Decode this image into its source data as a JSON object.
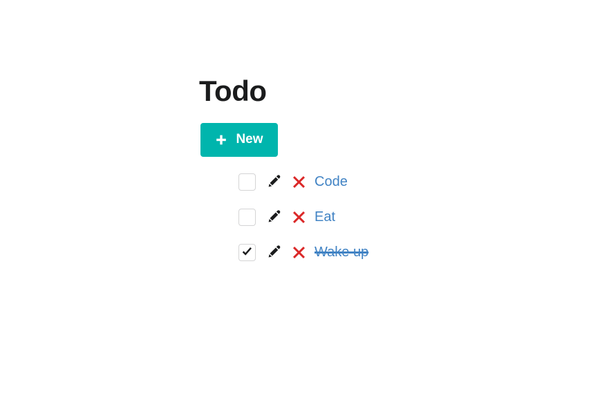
{
  "page": {
    "title": "Todo",
    "background_color": "#ffffff"
  },
  "toolbar": {
    "new_label": "New",
    "new_icon": "plus-icon",
    "accent_color": "#00b5ad",
    "new_text_color": "#ffffff"
  },
  "list": {
    "link_color": "#4183c4",
    "delete_color": "#db2828",
    "edit_color": "#1b1c1d",
    "checkbox_border_color": "#d4d4d5",
    "items": [
      {
        "label": "Code",
        "done": false,
        "checkbox_name": "todo-checkbox-code",
        "edit_name": "edit-todo-code-button",
        "delete_name": "delete-todo-code-button"
      },
      {
        "label": "Eat",
        "done": false,
        "checkbox_name": "todo-checkbox-eat",
        "edit_name": "edit-todo-eat-button",
        "delete_name": "delete-todo-eat-button"
      },
      {
        "label": "Wake up",
        "done": true,
        "checkbox_name": "todo-checkbox-wake-up",
        "edit_name": "edit-todo-wake-up-button",
        "delete_name": "delete-todo-wake-up-button"
      }
    ]
  },
  "icons": {
    "plus": "plus-icon",
    "edit": "pencil-icon",
    "delete": "x-mark-icon",
    "check": "check-icon"
  }
}
